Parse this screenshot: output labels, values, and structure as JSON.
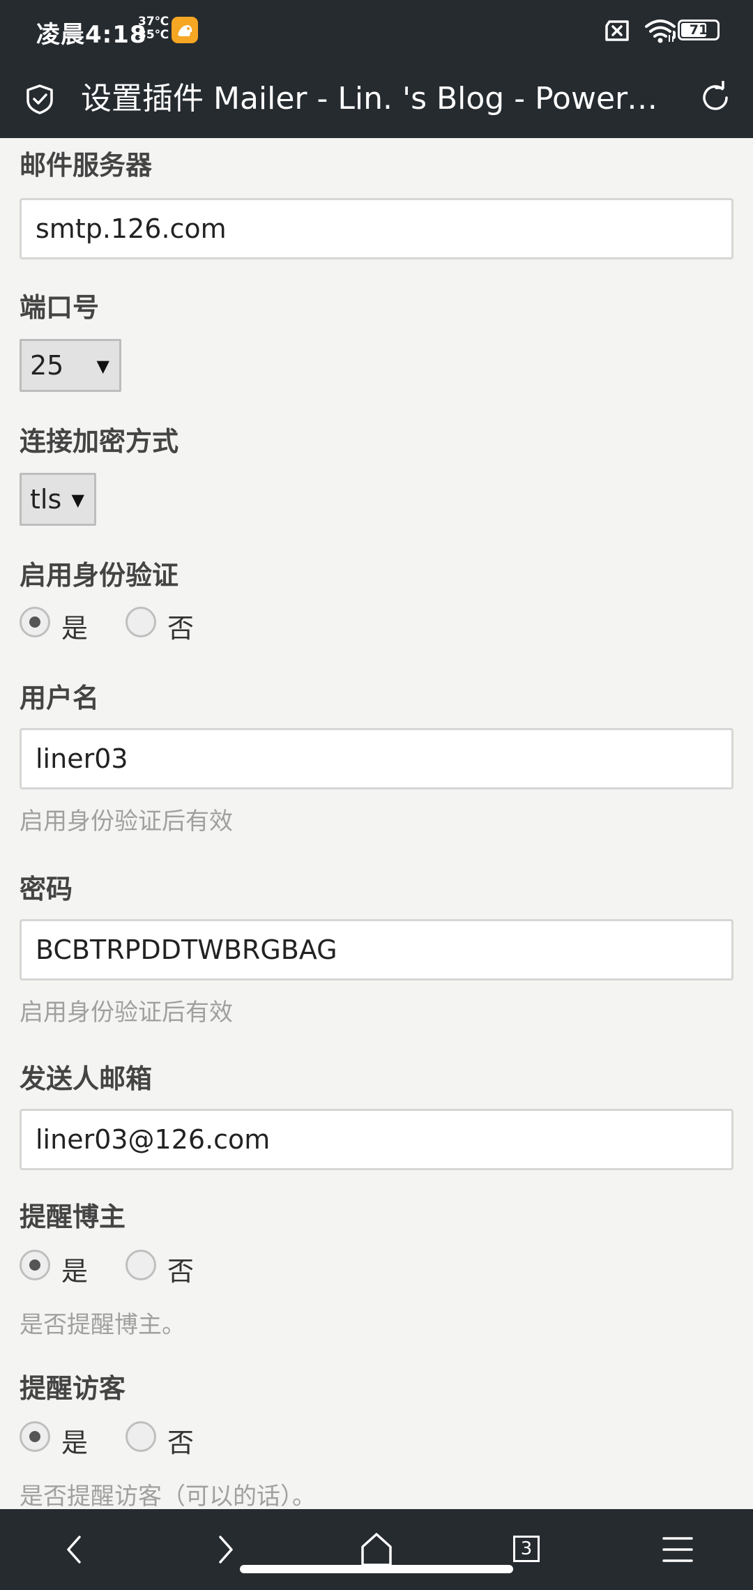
{
  "status_bar": {
    "time": "凌晨4:18",
    "temp_high": "37℃",
    "temp_low": "35℃",
    "battery": "71",
    "battery_level_percent": 71
  },
  "title_bar": {
    "title": "设置插件 Mailer - Lin. 's Blog - Powered by Typecho"
  },
  "form": {
    "mail_server": {
      "label": "邮件服务器",
      "value": "smtp.126.com"
    },
    "port": {
      "label": "端口号",
      "value": "25"
    },
    "encryption": {
      "label": "连接加密方式",
      "value": "tls"
    },
    "auth": {
      "label": "启用身份验证",
      "yes": "是",
      "no": "否",
      "selected": "是"
    },
    "username": {
      "label": "用户名",
      "value": "liner03",
      "hint": "启用身份验证后有效"
    },
    "password": {
      "label": "密码",
      "value": "BCBTRPDDTWBRGBAG",
      "hint": "启用身份验证后有效"
    },
    "sender": {
      "label": "发送人邮箱",
      "value": "liner03@126.com"
    },
    "notify_owner": {
      "label": "提醒博主",
      "yes": "是",
      "no": "否",
      "selected": "是",
      "hint": "是否提醒博主。"
    },
    "notify_visitor": {
      "label": "提醒访客",
      "yes": "是",
      "no": "否",
      "selected": "是",
      "hint": "是否提醒访客（可以的话）。"
    }
  },
  "bottom_nav": {
    "tab_count": "3",
    "icons": [
      "back-icon",
      "forward-icon",
      "home-icon",
      "tabs-icon",
      "menu-icon"
    ]
  },
  "colors": {
    "bar_background": "#262b30",
    "page_background": "#f4f4f2",
    "label_text": "#444444",
    "hint_text": "#a0a0a0"
  }
}
